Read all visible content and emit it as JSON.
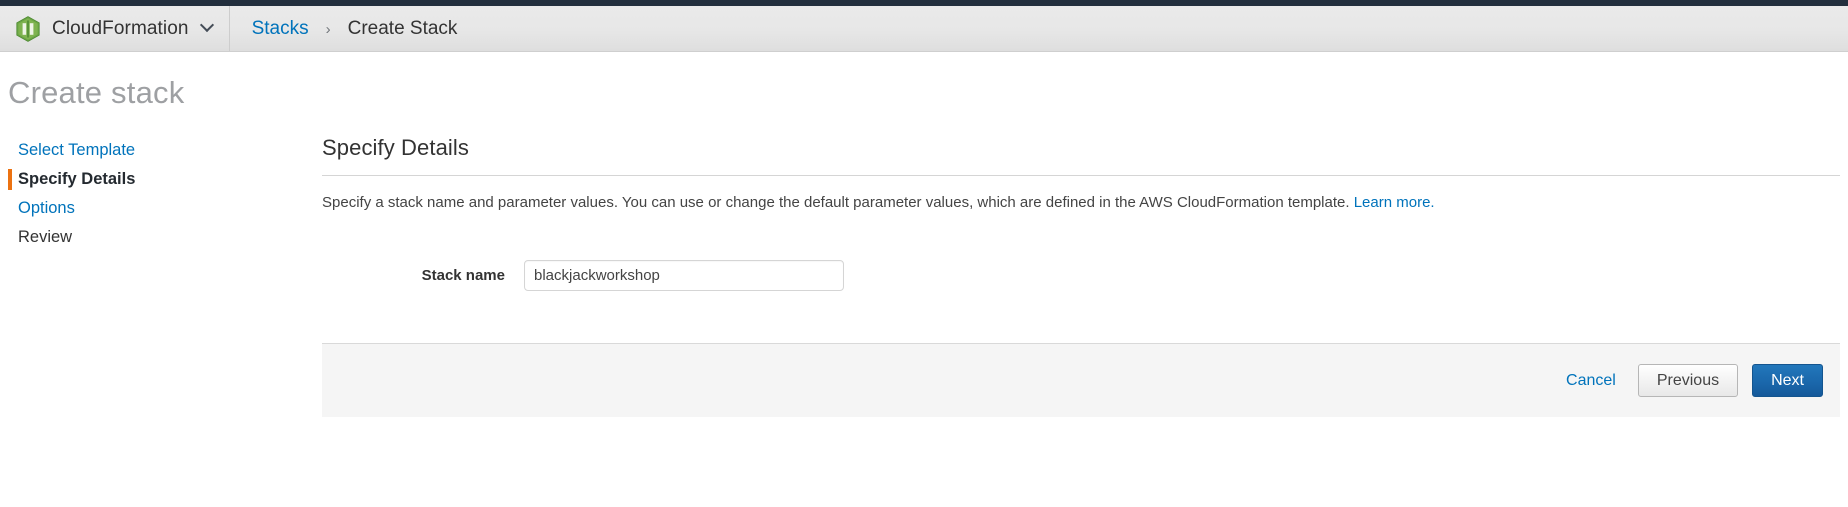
{
  "topbar": {
    "service_icon": "cloudformation-hexagon-icon",
    "service_name": "CloudFormation",
    "service_chevron_icon": "chevron-down-icon",
    "breadcrumb": {
      "parent": "Stacks",
      "separator": "›",
      "current": "Create Stack"
    }
  },
  "page": {
    "title": "Create stack"
  },
  "sidebar": {
    "items": [
      {
        "label": "Select Template",
        "state": "link"
      },
      {
        "label": "Specify Details",
        "state": "active"
      },
      {
        "label": "Options",
        "state": "link"
      },
      {
        "label": "Review",
        "state": "plain"
      }
    ]
  },
  "main": {
    "heading": "Specify Details",
    "description": "Specify a stack name and parameter values. You can use or change the default parameter values, which are defined in the AWS CloudFormation template.",
    "learn_more": "Learn more.",
    "form": {
      "stack_name_label": "Stack name",
      "stack_name_value": "blackjackworkshop",
      "stack_name_placeholder": ""
    }
  },
  "footer": {
    "cancel_label": "Cancel",
    "previous_label": "Previous",
    "next_label": "Next"
  },
  "colors": {
    "link": "#0073bb",
    "accent_orange": "#ec7211",
    "primary_button": "#1a66aa",
    "topbar_dark": "#232f3e",
    "service_green": "#6aa544"
  }
}
